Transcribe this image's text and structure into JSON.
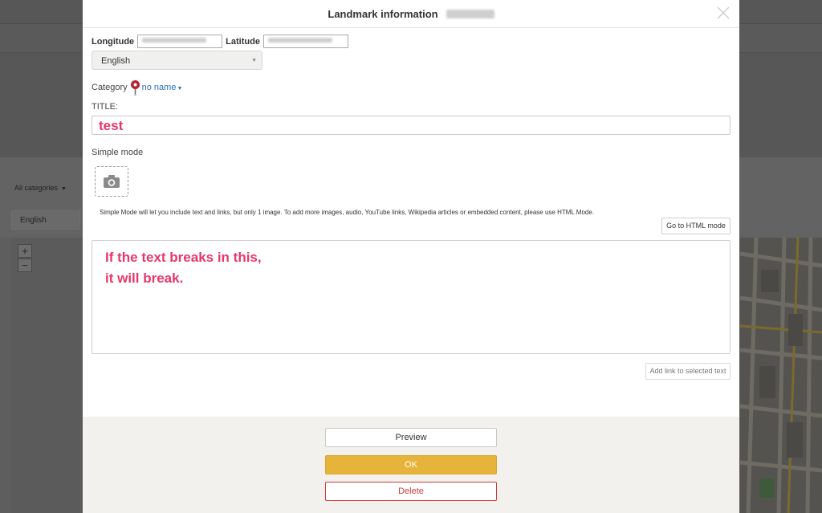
{
  "background": {
    "category_filter": "All categories",
    "language": "English",
    "zoom_in": "+",
    "zoom_out": "−"
  },
  "modal": {
    "title": "Landmark information",
    "longitude_label": "Longitude",
    "latitude_label": "Latitude",
    "language_selected": "English",
    "category_label": "Category",
    "category_value": "no name",
    "title_label": "TITLE:",
    "title_value": "test",
    "simple_mode_label": "Simple mode",
    "simple_mode_note": "Simple Mode will let you include text and links, but only 1 image. To add more images, audio, YouTube links, Wikipedia articles or embedded content, please use HTML Mode.",
    "html_mode_button": "Go to HTML mode",
    "body_line1": "If the text breaks in this,",
    "body_line2": "it will break.",
    "add_link_button": "Add link to selected text",
    "preview_button": "Preview",
    "ok_button": "OK",
    "delete_button": "Delete"
  },
  "colors": {
    "accent_ok": "#e6b43a",
    "delete": "#d43a3a",
    "annotation_text": "#e8366a",
    "link": "#2a6fb0"
  }
}
